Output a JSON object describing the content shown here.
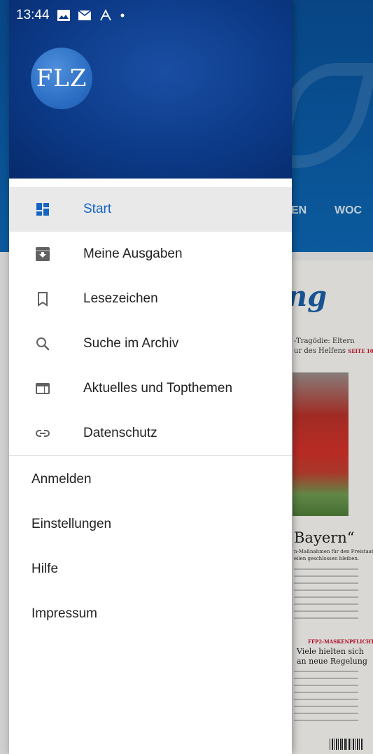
{
  "status_bar": {
    "time": "13:44",
    "icons": [
      "image-icon",
      "mail-icon",
      "font-icon",
      "dot-icon"
    ]
  },
  "drawer": {
    "logo_text": "FLZ",
    "menu": [
      {
        "label": "Start",
        "icon": "dashboard-icon",
        "active": true
      },
      {
        "label": "Meine Ausgaben",
        "icon": "archive-download-icon",
        "active": false
      },
      {
        "label": "Lesezeichen",
        "icon": "bookmark-icon",
        "active": false
      },
      {
        "label": "Suche im Archiv",
        "icon": "search-icon",
        "active": false
      },
      {
        "label": "Aktuelles und Topthemen",
        "icon": "web-icon",
        "active": false
      },
      {
        "label": "Datenschutz",
        "icon": "link-icon",
        "active": false
      }
    ],
    "secondary": [
      "Anmelden",
      "Einstellungen",
      "Hilfe",
      "Impressum"
    ],
    "colors": {
      "active_text": "#1565c0",
      "active_bg": "#e9e9e9",
      "header_bg": "#0c3a88",
      "logo_bg": "#2c6fc4"
    }
  },
  "background": {
    "tabs": [
      "EN",
      "WOC"
    ],
    "paper": {
      "logo": "ng",
      "headline_1": "-Tragödie: Eltern",
      "headline_2": "ur des Helfens",
      "headline_2_ref": "SEITE 10",
      "main_headline": "Bayern“",
      "sub_1": "n-Maßnahmen für den Freistaat,",
      "sub_2": "eilen geschlossen bleiben.",
      "section_label": "FFP2-MASKENPFLICHT",
      "section_headline_1": "Viele hielten sich",
      "section_headline_2": "an neue Regelung"
    }
  }
}
